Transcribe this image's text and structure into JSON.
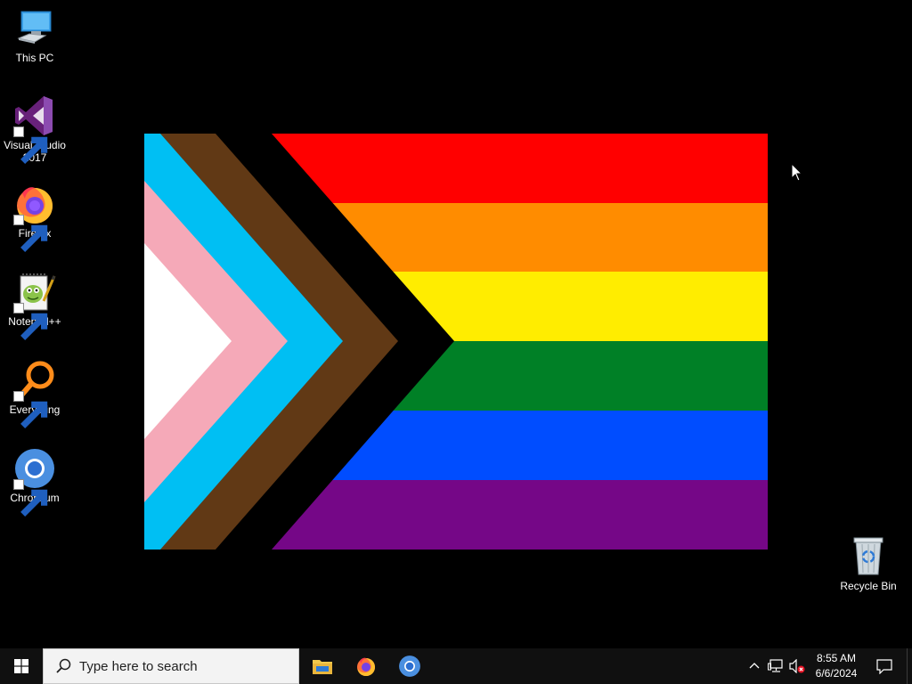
{
  "desktop": {
    "icons": [
      {
        "label": "This PC",
        "icon": "this-pc-icon"
      },
      {
        "label": "Visual Studio 2017",
        "icon": "visual-studio-icon"
      },
      {
        "label": "Firefox",
        "icon": "firefox-icon"
      },
      {
        "label": "Notepad++",
        "icon": "notepad-plus-plus-icon"
      },
      {
        "label": "Everything",
        "icon": "everything-search-icon"
      },
      {
        "label": "Chromium",
        "icon": "chromium-icon"
      },
      {
        "label": "Recycle Bin",
        "icon": "recycle-bin-icon"
      }
    ],
    "wallpaper": {
      "name": "progress-pride-flag",
      "stripes": [
        "#ff0000",
        "#ff8c00",
        "#ffed00",
        "#008026",
        "#004dff",
        "#750787"
      ],
      "chevrons": [
        "#000000",
        "#613915",
        "#00bff3",
        "#f5a9b8",
        "#ffffff"
      ]
    }
  },
  "taskbar": {
    "search_placeholder": "Type here to search",
    "pinned_apps": [
      "file-explorer-icon",
      "firefox-icon",
      "chromium-icon"
    ],
    "clock": {
      "time": "8:55 AM",
      "date": "6/6/2024"
    },
    "tray_icons": [
      "chevron-up-icon",
      "network-icon",
      "volume-muted-icon"
    ]
  }
}
